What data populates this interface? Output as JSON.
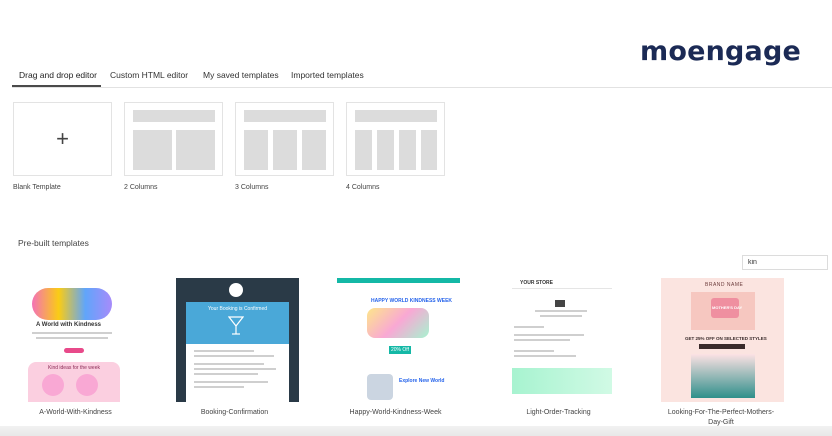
{
  "brand": {
    "logo_text": "moengage"
  },
  "tabs": [
    {
      "label": "Drag and drop editor",
      "active": true
    },
    {
      "label": "Custom HTML editor",
      "active": false
    },
    {
      "label": "My saved templates",
      "active": false
    },
    {
      "label": "Imported templates",
      "active": false
    }
  ],
  "layouts": [
    {
      "label": "Blank Template",
      "icon": "plus-icon"
    },
    {
      "label": "2 Columns"
    },
    {
      "label": "3 Columns"
    },
    {
      "label": "4 Columns"
    }
  ],
  "prebuilt": {
    "title": "Pre-built templates",
    "search_value": "kin",
    "templates": [
      {
        "name": "A-World-With-Kindness",
        "preview": {
          "heading": "A World with Kindness",
          "subheading": "Kind ideas for the week"
        }
      },
      {
        "name": "Booking-Confirmation",
        "preview": {
          "banner": "Your Booking is Confirmed"
        }
      },
      {
        "name": "Happy-World-Kindness-Week",
        "preview": {
          "heading": "HAPPY WORLD KINDNESS WEEK",
          "offer": "20% Off",
          "cta": "Explore New World"
        }
      },
      {
        "name": "Light-Order-Tracking",
        "preview": {
          "store": "YOUR STORE"
        }
      },
      {
        "name": "Looking-For-The-Perfect-Mothers-Day-Gift",
        "name_line2": "Day-Gift",
        "name_line1": "Looking-For-The-Perfect-Mothers-",
        "preview": {
          "brand": "BRAND NAME",
          "badge": "MOTHER'S DAY",
          "offer": "GET 25% OFF ON SELECTED STYLES"
        }
      }
    ]
  },
  "colors": {
    "brand_navy": "#1b2a55",
    "tab_underline": "#4a4a4a",
    "placeholder_gray": "#dcdcdc"
  }
}
